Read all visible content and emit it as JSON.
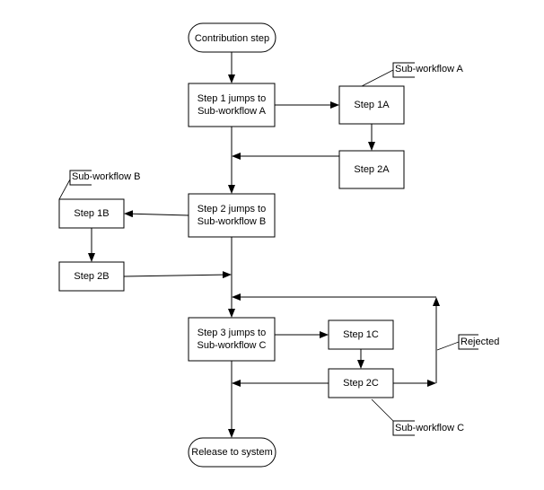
{
  "diagram": {
    "type": "flowchart",
    "nodes": {
      "start": "Contribution step",
      "step1": [
        "Step 1 jumps to",
        "Sub-workflow A"
      ],
      "step1a": "Step 1A",
      "step2a": "Step 2A",
      "step2": [
        "Step 2 jumps to",
        "Sub-workflow B"
      ],
      "step1b": "Step 1B",
      "step2b": "Step 2B",
      "step3": [
        "Step 3 jumps to",
        "Sub-workflow C"
      ],
      "step1c": "Step 1C",
      "step2c": "Step 2C",
      "end": "Release to system"
    },
    "callouts": {
      "subA": "Sub-workflow A",
      "subB": "Sub-workflow B",
      "subC": "Sub-workflow C",
      "rejected": "Rejected"
    },
    "edges": [
      {
        "from": "start",
        "to": "step1"
      },
      {
        "from": "step1",
        "to": "step1a"
      },
      {
        "from": "step1a",
        "to": "step2a"
      },
      {
        "from": "step2a",
        "to": "step1-step2 connector"
      },
      {
        "from": "step1",
        "to": "step2"
      },
      {
        "from": "step2",
        "to": "step1b"
      },
      {
        "from": "step1b",
        "to": "step2b"
      },
      {
        "from": "step2b",
        "to": "step2-step3 connector"
      },
      {
        "from": "step2",
        "to": "step3"
      },
      {
        "from": "step3",
        "to": "step1c"
      },
      {
        "from": "step1c",
        "to": "step2c"
      },
      {
        "from": "step2c",
        "to": "step3-end connector"
      },
      {
        "from": "step2c",
        "to": "step2-step3 connector",
        "label": "Rejected"
      },
      {
        "from": "step3",
        "to": "end"
      }
    ]
  }
}
